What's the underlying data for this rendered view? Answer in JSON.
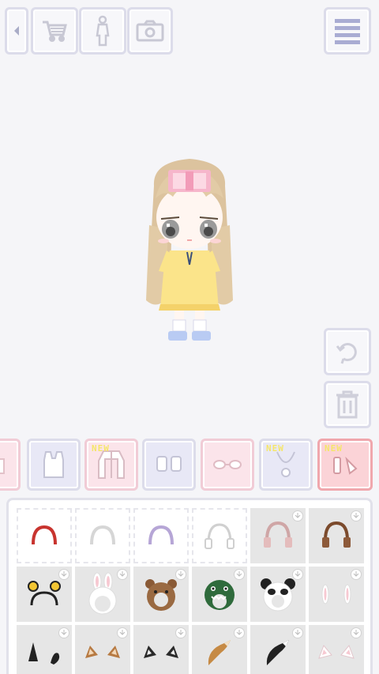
{
  "toolbar": {
    "back_icon": "triangle-left-icon",
    "shop_icon": "shopping-cart-icon",
    "body_icon": "body-silhouette-icon",
    "camera_icon": "camera-icon",
    "menu_icon": "hamburger-menu-icon"
  },
  "side_actions": {
    "rotate_icon": "rotate-icon",
    "trash_icon": "trash-icon"
  },
  "categories": [
    {
      "id": "partial-left",
      "style": "pink",
      "badge": ""
    },
    {
      "id": "tops",
      "style": "lavender",
      "badge": ""
    },
    {
      "id": "outerwear",
      "style": "pink",
      "badge": "NEW"
    },
    {
      "id": "socks",
      "style": "lavender",
      "badge": ""
    },
    {
      "id": "glasses",
      "style": "pink",
      "badge": ""
    },
    {
      "id": "necklaces",
      "style": "lavender",
      "badge": "NEW"
    },
    {
      "id": "accessories",
      "style": "red",
      "badge": "NEW"
    }
  ],
  "colors": {
    "background": "#f5f5f8",
    "button_border": "#dcdcea",
    "category_lavender": "#e8e8f6",
    "category_pink": "#fbe4ea",
    "category_selected": "#fbd3d7",
    "new_badge": "#f5e66a",
    "locked_cell": "#e6e6e6"
  },
  "items": [
    {
      "name": "red-headband",
      "locked": false
    },
    {
      "name": "white-headband",
      "locked": false
    },
    {
      "name": "purple-headband",
      "locked": false
    },
    {
      "name": "white-headphones",
      "locked": false
    },
    {
      "name": "pink-headphones",
      "locked": true
    },
    {
      "name": "brown-headphones",
      "locked": true
    },
    {
      "name": "bee-antenna-headband",
      "locked": true
    },
    {
      "name": "bunny-hood",
      "locked": true
    },
    {
      "name": "bear-hood",
      "locked": true
    },
    {
      "name": "dino-hood",
      "locked": true
    },
    {
      "name": "panda-hood",
      "locked": true
    },
    {
      "name": "white-bunny-ears",
      "locked": true
    },
    {
      "name": "black-cat-ears",
      "locked": true
    },
    {
      "name": "brown-cat-ears",
      "locked": true
    },
    {
      "name": "black-tipped-ears",
      "locked": true
    },
    {
      "name": "fox-tail",
      "locked": true
    },
    {
      "name": "black-tail",
      "locked": true
    },
    {
      "name": "pink-cat-ears",
      "locked": true
    }
  ]
}
